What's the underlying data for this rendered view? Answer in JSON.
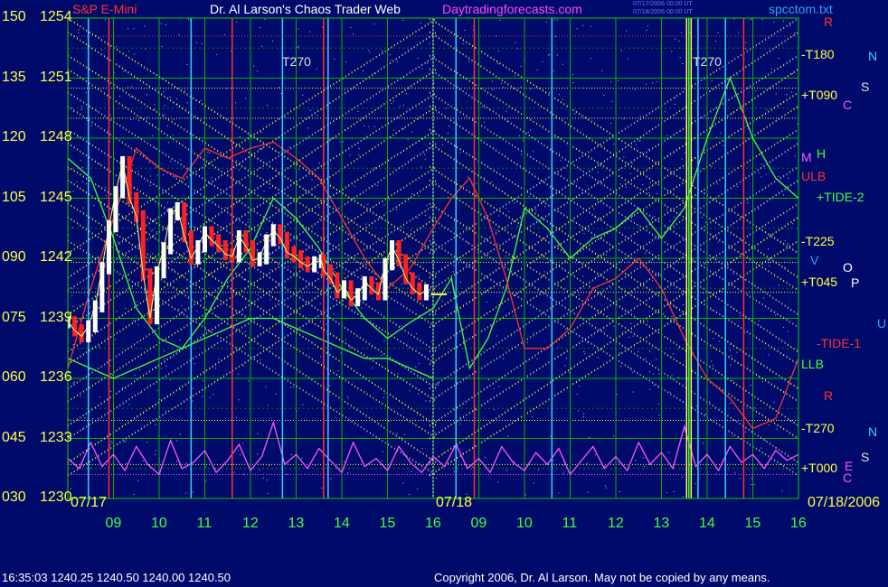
{
  "header": {
    "symbol": "S&P E-Mini",
    "title": "Dr. Al Larson's Chaos Trader Web",
    "site": "Daytradingforecasts.com",
    "file": "spcctom.txt",
    "stamp1": "07/17/2006 00:00 UT",
    "stamp2": "07/18/2006 00:00 UT"
  },
  "footer": {
    "quote": "16:35:03  1240.25 1240.50 1240.00 1240.50",
    "copyright": "Copyright 2006, Dr. Al Larson. May not be copied by any means."
  },
  "chart_data": {
    "type": "line",
    "title": "S&P E-Mini",
    "oscillator_ticks": [
      "150",
      "135",
      "120",
      "105",
      "090",
      "075",
      "060",
      "045",
      "030"
    ],
    "price_ticks": [
      "1254",
      "1251",
      "1248",
      "1245",
      "1242",
      "1239",
      "1236",
      "1233",
      "1230"
    ],
    "ylim": [
      1230,
      1254
    ],
    "dates": {
      "left": "07/17",
      "mid": "07/18",
      "right": "07/18/2006"
    },
    "x_ticks": {
      "day1": [
        "09",
        "10",
        "11",
        "12",
        "13",
        "14",
        "15",
        "16"
      ],
      "day2": [
        "09",
        "10",
        "11",
        "12",
        "13",
        "14",
        "15",
        "16"
      ]
    },
    "right_labels": [
      {
        "text": "R",
        "color": "#ff3030"
      },
      {
        "text": "-T180",
        "color": "#ffff40"
      },
      {
        "text": "N",
        "color": "#30d0ff"
      },
      {
        "text": "S",
        "color": "#e0e0e0"
      },
      {
        "text": "+T090",
        "color": "#ffff40"
      },
      {
        "text": "C",
        "color": "#ff50ff"
      },
      {
        "text": "M",
        "color": "#ff50ff"
      },
      {
        "text": "H",
        "color": "#40ff40"
      },
      {
        "text": "ULB",
        "color": "#ff3030"
      },
      {
        "text": "+TIDE-2",
        "color": "#40ff40"
      },
      {
        "text": "-T225",
        "color": "#ffff40"
      },
      {
        "text": "V",
        "color": "#30a0ff"
      },
      {
        "text": "O",
        "color": "#ffffff"
      },
      {
        "text": "+T045",
        "color": "#ffff40"
      },
      {
        "text": "P",
        "color": "#ffffff"
      },
      {
        "text": "U",
        "color": "#30a0ff"
      },
      {
        "text": "-TIDE-1",
        "color": "#ff3030"
      },
      {
        "text": "LLB",
        "color": "#40ff40"
      },
      {
        "text": "R",
        "color": "#ff3030"
      },
      {
        "text": "-T270",
        "color": "#ffff40"
      },
      {
        "text": "N",
        "color": "#30d0ff"
      },
      {
        "text": "S",
        "color": "#e0e0e0"
      },
      {
        "text": "+T000",
        "color": "#ffff40"
      },
      {
        "text": "E",
        "color": "#ff50ff"
      },
      {
        "text": "C",
        "color": "#ff50ff"
      }
    ],
    "t270_labels": [
      "T270",
      "T270"
    ],
    "series": [
      {
        "name": "S&P E-Mini",
        "color": "#ffffff",
        "x": [
          0.0,
          0.15,
          0.3,
          0.45,
          0.6,
          0.75,
          0.9,
          1.05,
          1.2,
          1.35,
          1.5,
          1.65,
          1.8,
          1.95,
          2.1,
          2.25,
          2.4,
          2.55,
          2.7,
          2.85,
          3.0,
          3.15,
          3.3,
          3.45,
          3.6,
          3.75,
          3.9,
          4.05,
          4.2,
          4.35,
          4.5,
          4.65,
          4.8,
          4.95,
          5.1,
          5.25,
          5.4,
          5.55,
          5.6,
          5.75,
          5.9,
          6.05,
          6.2,
          6.35,
          6.5,
          6.65,
          6.8,
          6.95,
          7.1,
          7.25,
          7.4,
          7.55,
          7.7,
          7.85
        ],
        "values": [
          1238.8,
          1238.4,
          1238.1,
          1238.6,
          1239.6,
          1241.5,
          1243.6,
          1245.3,
          1246.8,
          1245.0,
          1244.1,
          1241.2,
          1239.0,
          1241.3,
          1242.5,
          1244.2,
          1244.5,
          1243.1,
          1242.0,
          1242.6,
          1243.3,
          1242.9,
          1242.6,
          1242.2,
          1242.1,
          1243.1,
          1242.6,
          1241.9,
          1242.0,
          1242.9,
          1243.4,
          1243.0,
          1242.3,
          1242.1,
          1241.8,
          1241.6,
          1241.8,
          1241.9,
          1241.4,
          1241.0,
          1240.3,
          1240.6,
          1239.9,
          1240.2,
          1240.8,
          1240.5,
          1240.2,
          1241.7,
          1242.6,
          1241.9,
          1241.0,
          1240.5,
          1240.2,
          1240.4
        ]
      },
      {
        "name": "+TIDE-2",
        "color": "#40ff40",
        "x": [
          0.0,
          0.5,
          1.0,
          1.5,
          2.0,
          2.5,
          3.0,
          3.5,
          4.0,
          4.5,
          5.0,
          5.5,
          6.0,
          6.5,
          7.0,
          7.5,
          8.0,
          8.4,
          8.8,
          9.2,
          9.6,
          10.0,
          10.5,
          11.0,
          11.5,
          12.0,
          12.5,
          13.0,
          13.5,
          14.0,
          14.5,
          15.0,
          15.5,
          16.0
        ],
        "values": [
          1247.0,
          1246.0,
          1243.0,
          1239.5,
          1238.0,
          1237.5,
          1239.0,
          1241.0,
          1242.5,
          1245.0,
          1244.0,
          1242.5,
          1240.5,
          1239.0,
          1238.0,
          1238.8,
          1239.5,
          1241.0,
          1236.5,
          1238.0,
          1240.5,
          1244.5,
          1243.5,
          1242.0,
          1243.0,
          1243.5,
          1244.5,
          1243.0,
          1244.5,
          1248.0,
          1251.0,
          1248.0,
          1246.0,
          1245.0
        ]
      },
      {
        "name": "-TIDE-1",
        "color": "#ff3030",
        "x": [
          0.0,
          0.5,
          1.0,
          1.5,
          2.0,
          2.5,
          3.0,
          3.5,
          4.0,
          4.5,
          5.0,
          5.5,
          6.0,
          6.5,
          7.0,
          7.5,
          8.0,
          8.4,
          8.8,
          9.2,
          9.6,
          10.0,
          10.5,
          11.0,
          11.5,
          12.0,
          12.5,
          13.0,
          13.5,
          14.0,
          14.5,
          15.0,
          15.5,
          16.0
        ],
        "values": [
          1236.5,
          1240.5,
          1244.0,
          1247.5,
          1246.5,
          1246.0,
          1247.5,
          1247.0,
          1247.5,
          1247.8,
          1247.0,
          1246.0,
          1244.0,
          1242.0,
          1240.5,
          1241.5,
          1243.5,
          1245.0,
          1246.0,
          1244.0,
          1241.0,
          1237.5,
          1237.5,
          1238.5,
          1240.5,
          1241.0,
          1242.0,
          1240.5,
          1238.0,
          1236.0,
          1235.0,
          1233.5,
          1234.0,
          1237.0
        ]
      },
      {
        "name": "LLB",
        "color": "#40ff40",
        "x": [
          0.0,
          0.5,
          1.0,
          1.5,
          2.0,
          2.5,
          3.0,
          3.5,
          4.0,
          4.5,
          5.0,
          5.5,
          6.0,
          6.5,
          7.0,
          7.5,
          8.0
        ],
        "values": [
          1237.0,
          1236.5,
          1236.0,
          1236.5,
          1237.0,
          1237.5,
          1238.0,
          1238.5,
          1239.0,
          1239.0,
          1238.5,
          1238.0,
          1237.5,
          1237.0,
          1237.0,
          1236.5,
          1236.0
        ]
      },
      {
        "name": "C",
        "color": "#ff50ff",
        "x": [
          0.0,
          0.25,
          0.5,
          0.75,
          1.0,
          1.25,
          1.5,
          1.75,
          2.0,
          2.25,
          2.5,
          2.75,
          3.0,
          3.25,
          3.5,
          3.75,
          4.0,
          4.25,
          4.5,
          4.75,
          5.0,
          5.25,
          5.5,
          5.75,
          6.0,
          6.25,
          6.5,
          6.75,
          7.0,
          7.25,
          7.5,
          7.75,
          8.0,
          8.25,
          8.5,
          8.75,
          9.0,
          9.25,
          9.5,
          9.75,
          10.0,
          10.25,
          10.5,
          10.75,
          11.0,
          11.25,
          11.5,
          11.75,
          12.0,
          12.25,
          12.5,
          12.75,
          13.0,
          13.25,
          13.5,
          13.75,
          14.0,
          14.25,
          14.5,
          14.75,
          15.0,
          15.25,
          15.5,
          15.75,
          16.0
        ],
        "values": [
          1232.0,
          1231.5,
          1232.8,
          1231.6,
          1232.2,
          1231.4,
          1232.6,
          1231.7,
          1231.2,
          1232.9,
          1231.5,
          1231.8,
          1232.4,
          1231.3,
          1231.9,
          1232.7,
          1231.4,
          1232.1,
          1233.8,
          1231.7,
          1232.2,
          1231.5,
          1232.5,
          1231.9,
          1231.3,
          1232.8,
          1231.6,
          1232.0,
          1231.4,
          1232.6,
          1231.8,
          1231.3,
          1232.1,
          1231.6,
          1232.7,
          1231.5,
          1232.0,
          1231.3,
          1232.6,
          1231.8,
          1231.4,
          1232.3,
          1231.7,
          1232.5,
          1231.2,
          1231.9,
          1232.6,
          1231.5,
          1232.1,
          1231.4,
          1232.8,
          1231.7,
          1232.3,
          1231.5,
          1233.6,
          1231.6,
          1232.2,
          1231.4,
          1232.6,
          1231.8,
          1232.2,
          1231.5,
          1232.4,
          1231.9,
          1232.2
        ]
      }
    ]
  }
}
